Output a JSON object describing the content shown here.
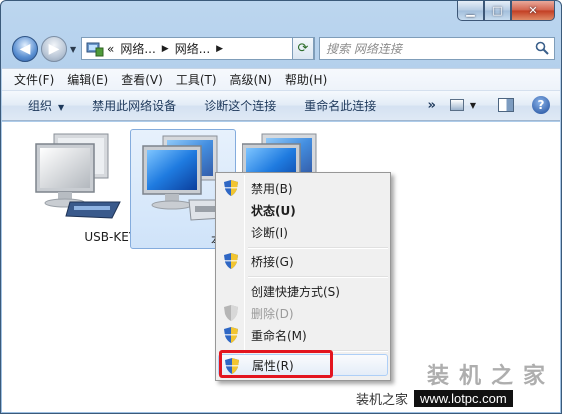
{
  "window": {
    "caption_buttons": [
      "minimize",
      "maximize",
      "close"
    ]
  },
  "nav": {
    "address_segments": [
      "网络...",
      "网络..."
    ],
    "address_prefix": "«",
    "search_placeholder": "搜索 网络连接"
  },
  "menubar": {
    "items": [
      "文件(F)",
      "编辑(E)",
      "查看(V)",
      "工具(T)",
      "高级(N)",
      "帮助(H)"
    ]
  },
  "cmdbar": {
    "organize": "组织",
    "disable": "禁用此网络设备",
    "diagnose": "诊断这个连接",
    "rename": "重命名此连接",
    "more": "»"
  },
  "items": [
    {
      "label": "USB-KEY DIAL"
    },
    {
      "label": "本地连接"
    }
  ],
  "context_menu": {
    "items": [
      {
        "label": "禁用(B)",
        "shield": true,
        "bold": false,
        "disabled": false
      },
      {
        "label": "状态(U)",
        "shield": false,
        "bold": true,
        "disabled": false
      },
      {
        "label": "诊断(I)",
        "shield": false,
        "bold": false,
        "disabled": false
      },
      {
        "label": "桥接(G)",
        "shield": true,
        "bold": false,
        "disabled": false
      },
      {
        "label": "创建快捷方式(S)",
        "shield": false,
        "bold": false,
        "disabled": false
      },
      {
        "label": "删除(D)",
        "shield": true,
        "bold": false,
        "disabled": true
      },
      {
        "label": "重命名(M)",
        "shield": true,
        "bold": false,
        "disabled": false
      },
      {
        "label": "属性(R)",
        "shield": true,
        "bold": false,
        "disabled": false,
        "highlighted": true
      }
    ]
  },
  "watermark": {
    "large": "装机之家",
    "small_cn": "装机之家",
    "url": "www.lotpc.com"
  },
  "colors": {
    "highlight_border": "#e3151f",
    "selection": "#cfe3f9"
  }
}
